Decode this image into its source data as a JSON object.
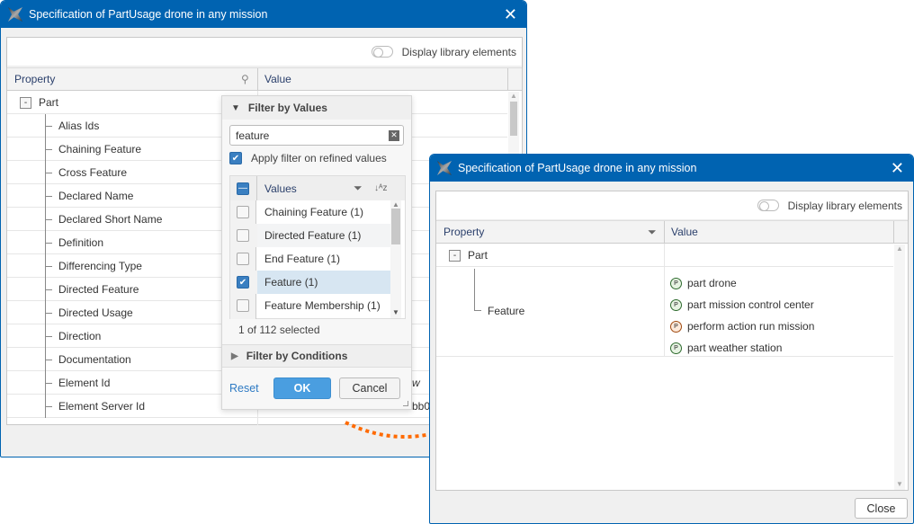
{
  "left_dialog": {
    "title": "Specification of PartUsage drone in any mission",
    "display_library_label": "Display library elements",
    "col_property": "Property",
    "col_value": "Value",
    "group": "Part",
    "rows": [
      "Alias Ids",
      "Chaining Feature",
      "Cross Feature",
      "Declared Name",
      "Declared Short Name",
      "Definition",
      "Differencing Type",
      "Directed Feature",
      "Directed Usage",
      "Direction",
      "Documentation",
      "Element Id",
      "Element Server Id"
    ],
    "partial_values": {
      "element_id": "w",
      "element_server_id": "bb0"
    }
  },
  "filter_popup": {
    "filter_by_values": "Filter by Values",
    "search_value": "feature",
    "apply_refined_label": "Apply filter on refined values",
    "apply_refined_checked": true,
    "values_header": "Values",
    "values": [
      {
        "label": "Chaining Feature (1)",
        "checked": false
      },
      {
        "label": "Directed Feature (1)",
        "checked": false
      },
      {
        "label": "End Feature (1)",
        "checked": false
      },
      {
        "label": "Feature (1)",
        "checked": true
      },
      {
        "label": "Feature Membership (1)",
        "checked": false
      }
    ],
    "selected_count": "1 of 112 selected",
    "filter_by_conditions": "Filter by Conditions",
    "reset": "Reset",
    "ok": "OK",
    "cancel": "Cancel"
  },
  "right_dialog": {
    "title": "Specification of PartUsage drone in any mission",
    "display_library_label": "Display library elements",
    "col_property": "Property",
    "col_value": "Value",
    "group": "Part",
    "property": "Feature",
    "values": [
      "part drone",
      "part mission control center",
      "perform action run mission",
      "part weather station"
    ],
    "close": "Close"
  },
  "colors": {
    "titlebar": "#0063b1",
    "accent": "#3a7fc1",
    "arrow": "#ff6a00"
  }
}
